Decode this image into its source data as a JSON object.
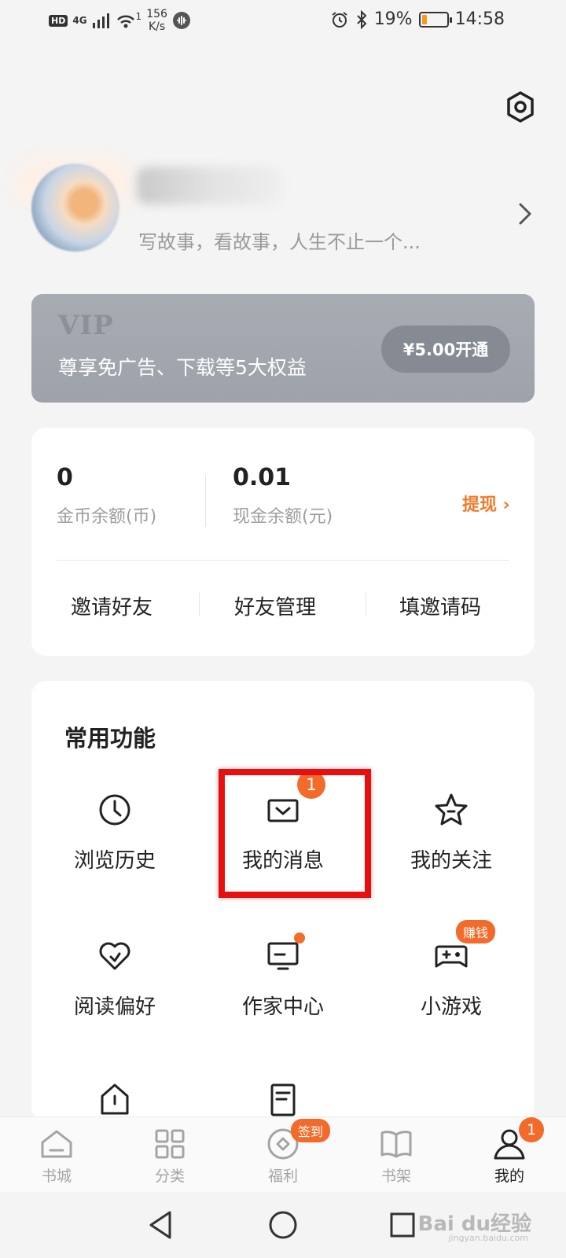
{
  "status_bar": {
    "hd": "HD",
    "network": "4G",
    "wifi_sub": "1",
    "speed_value": "156",
    "speed_unit": "K/s",
    "battery_percent": "19%",
    "battery_level": 0.19,
    "time": "14:58"
  },
  "profile": {
    "username": "",
    "bio": "写故事，看故事，人生不止一个..."
  },
  "vip": {
    "logo": "VIP",
    "description": "尊享免广告、下载等5大权益",
    "button_label": "¥5.00开通"
  },
  "balance": {
    "coins_value": "0",
    "coins_label": "金币余额(币)",
    "cash_value": "0.01",
    "cash_label": "现金余额(元)",
    "withdraw_label": "提现 ›",
    "links": [
      "邀请好友",
      "好友管理",
      "填邀请码"
    ]
  },
  "functions": {
    "title": "常用功能",
    "items": [
      {
        "label": "浏览历史",
        "icon": "clock-icon"
      },
      {
        "label": "我的消息",
        "icon": "message-icon",
        "badge": "1"
      },
      {
        "label": "我的关注",
        "icon": "star-icon"
      },
      {
        "label": "阅读偏好",
        "icon": "heart-icon"
      },
      {
        "label": "作家中心",
        "icon": "monitor-icon",
        "dot": true
      },
      {
        "label": "小游戏",
        "icon": "gamepad-icon",
        "badge": "赚钱"
      }
    ]
  },
  "bottom_nav": {
    "items": [
      {
        "label": "书城",
        "icon": "home-icon"
      },
      {
        "label": "分类",
        "icon": "grid-icon"
      },
      {
        "label": "福利",
        "icon": "gift-icon",
        "badge": "签到"
      },
      {
        "label": "书架",
        "icon": "book-icon"
      },
      {
        "label": "我的",
        "icon": "user-icon",
        "badge": "1",
        "active": true
      }
    ]
  },
  "watermark": {
    "text": "Bai du经验",
    "sub": "jingyan.baidu.com"
  },
  "colors": {
    "accent": "#f26b2a",
    "highlight": "#ea0f0f",
    "vip_bg": "#a3a7ae"
  }
}
